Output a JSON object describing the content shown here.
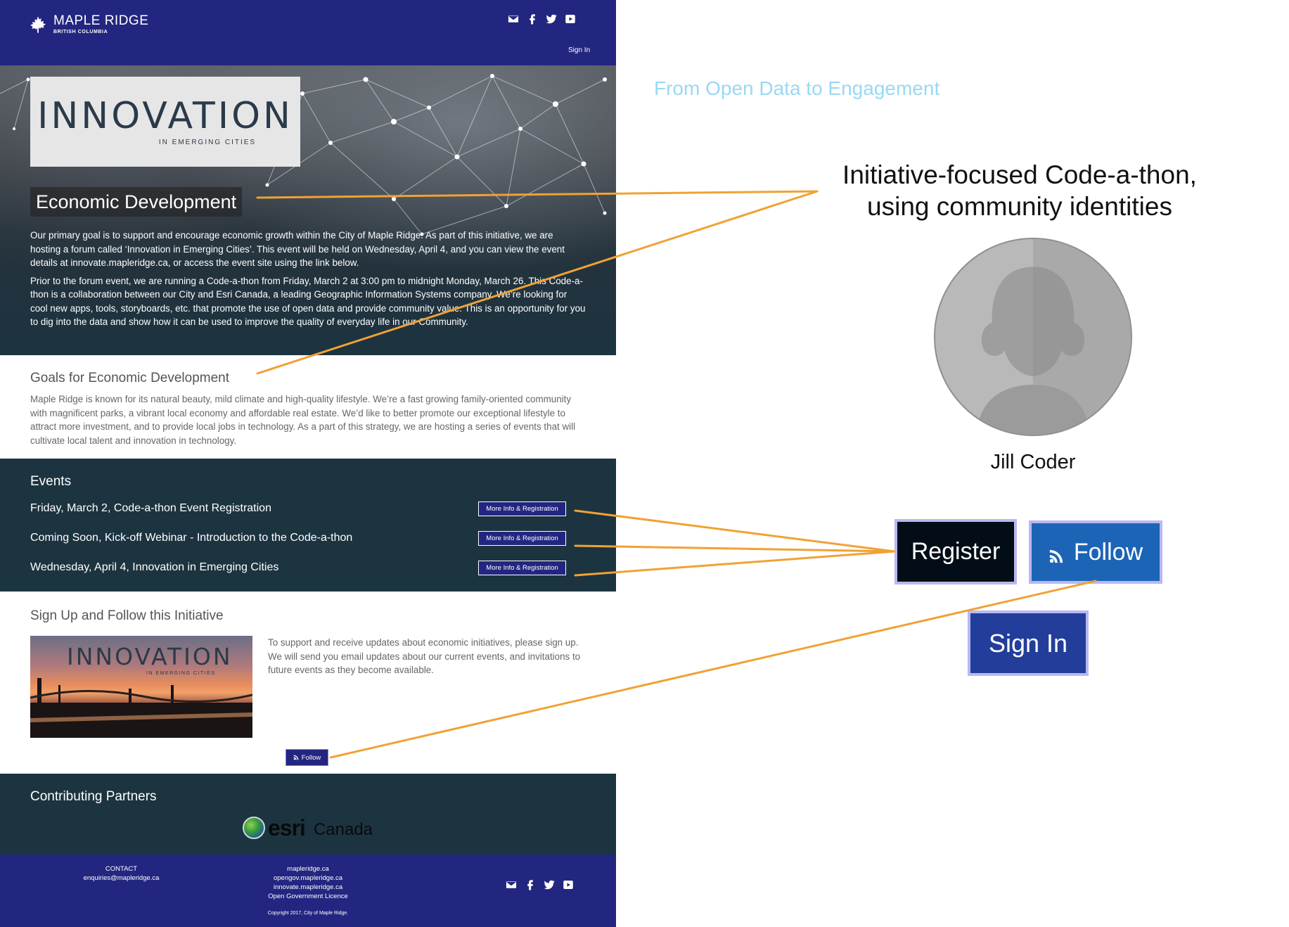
{
  "header": {
    "brand_name": "MAPLE RIDGE",
    "brand_sub": "BRITISH COLUMBIA",
    "signin_label": "Sign In",
    "social_icons": [
      "email-icon",
      "facebook-icon",
      "twitter-icon",
      "youtube-icon"
    ]
  },
  "hero": {
    "logo_word": "INNOVATION",
    "logo_sub": "IN EMERGING CITIES",
    "title": "Economic Development",
    "para1": "Our primary goal is to support and encourage economic growth within the City of Maple Ridge. As part of this initiative, we are hosting a forum called ‘Innovation in Emerging Cities’. This event will be held on Wednesday, April 4, and you can view the event details at innovate.mapleridge.ca, or access the event site using the link below.",
    "para2": "Prior to the forum event, we are running a Code-a-thon from Friday, March 2 at 3:00 pm to midnight Monday, March 26. This Code-a-thon is a collaboration between our City and Esri Canada, a leading Geographic Information Systems company. We’re looking for cool new apps, tools, storyboards, etc. that promote the use of open data and provide community value. This is an opportunity for you to dig into the data and show how it can be used to improve the quality of everyday life in our Community."
  },
  "goals": {
    "title": "Goals for Economic Development",
    "text": "Maple Ridge is known for its natural beauty, mild climate and high-quality lifestyle. We’re a fast growing family-oriented community with magnificent parks, a vibrant local economy and affordable real estate. We’d like to better promote our exceptional lifestyle to attract more investment, and to provide local jobs in technology. As a part of this strategy, we are hosting a series of events that will cultivate local talent and innovation in technology."
  },
  "events": {
    "title": "Events",
    "items": [
      {
        "label": "Friday, March 2, Code-a-thon Event Registration",
        "button": "More Info & Registration"
      },
      {
        "label": "Coming Soon, Kick-off Webinar - Introduction to the Code-a-thon",
        "button": "More Info & Registration"
      },
      {
        "label": "Wednesday, April 4, Innovation in Emerging Cities",
        "button": "More Info & Registration"
      }
    ]
  },
  "signup": {
    "title": "Sign Up and Follow this Initiative",
    "image_word": "INNOVATION",
    "image_sub": "IN EMERGING CITIES",
    "text": "To support and receive updates about economic initiatives, please sign up. We will send you email updates about our current events, and invitations to future events as they become available.",
    "follow_label": "Follow"
  },
  "partners": {
    "title": "Contributing Partners",
    "esri_word": "esri",
    "esri_country": "Canada"
  },
  "footer": {
    "contact_title": "CONTACT",
    "contact_email": "enquiries@mapleridge.ca",
    "links": [
      "mapleridge.ca",
      "opengov.mapleridge.ca",
      "innovate.mapleridge.ca",
      "Open Government Licence"
    ],
    "copyright": "Copyright 2017, City of Maple Ridge."
  },
  "annotation": {
    "slide_title": "From Open Data to Engagement",
    "heading_line1": "Initiative-focused Code-a-thon,",
    "heading_line2": "using community identities",
    "user_name": "Jill Coder",
    "register_label": "Register",
    "follow_label": "Follow",
    "signin_label": "Sign In",
    "arrow_color": "#f0a235"
  }
}
